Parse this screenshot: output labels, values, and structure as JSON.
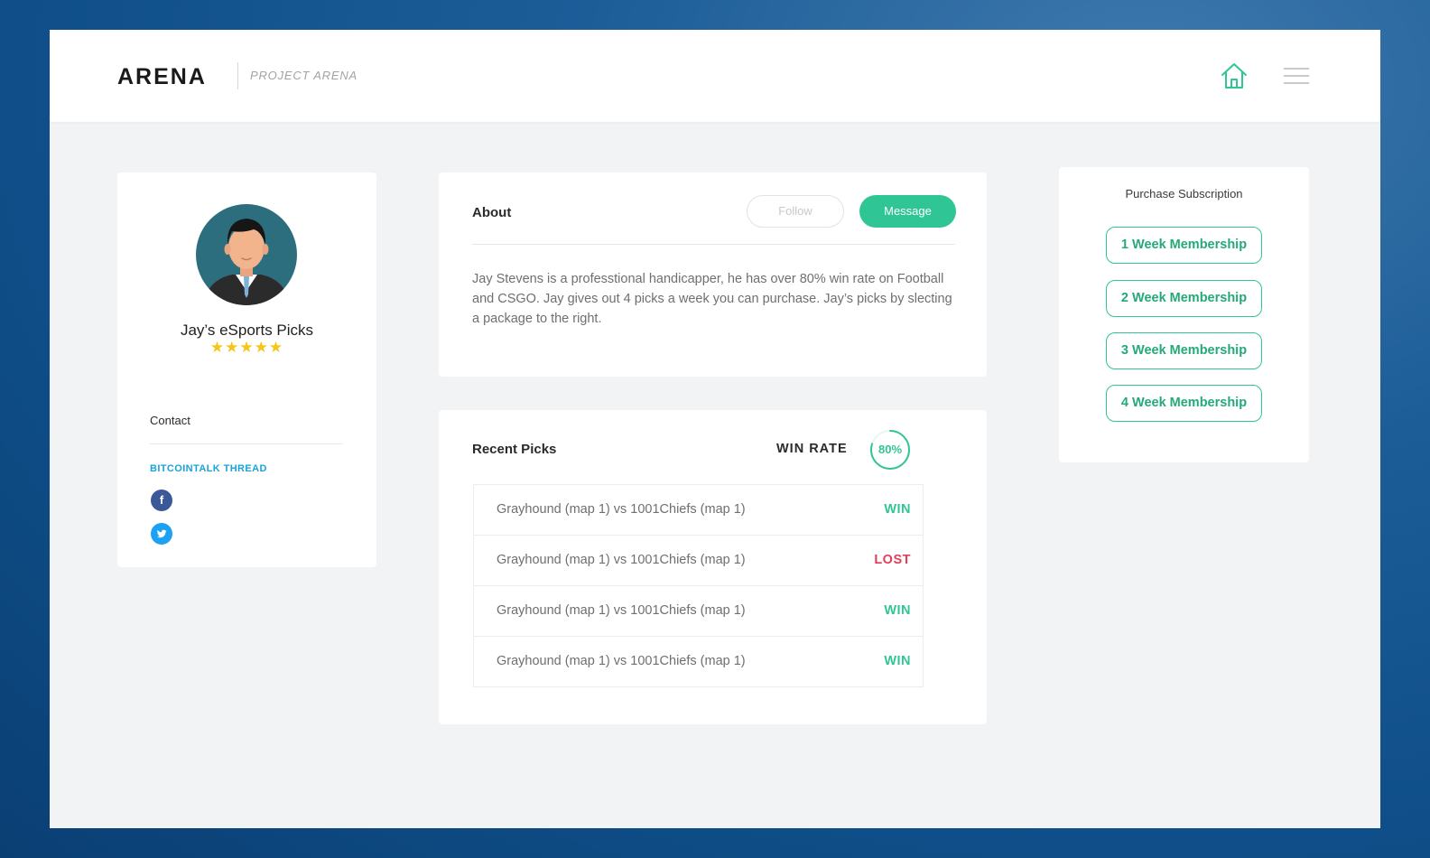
{
  "header": {
    "logo": "ARENA",
    "project_label": "PROJECT ARENA"
  },
  "profile": {
    "name": "Jay’s eSports Picks",
    "rating": 5,
    "stars": "★★★★★",
    "contact_label": "Contact",
    "thread_link": "BITCOINTALK THREAD",
    "facebook_glyph": "f"
  },
  "about": {
    "title": "About",
    "follow_label": "Follow",
    "message_label": "Message",
    "text": "Jay Stevens is a professtional handicapper, he has over 80% win rate on Football and CSGO. Jay gives out 4 picks a week you can purchase. Jay’s picks by slecting a package to the right."
  },
  "picks": {
    "title": "Recent Picks",
    "win_rate_label": "WIN RATE",
    "win_rate_value": "80%",
    "win_rate_fraction": 0.8,
    "rows": [
      {
        "match": "Grayhound (map 1) vs 1001Chiefs (map 1)",
        "result": "WIN"
      },
      {
        "match": "Grayhound (map 1) vs 1001Chiefs (map 1)",
        "result": "LOST"
      },
      {
        "match": "Grayhound (map 1) vs 1001Chiefs (map 1)",
        "result": "WIN"
      },
      {
        "match": "Grayhound (map 1) vs 1001Chiefs (map 1)",
        "result": "WIN"
      }
    ]
  },
  "subscription": {
    "title": "Purchase Subscription",
    "options": [
      {
        "label": "1 Week Membership"
      },
      {
        "label": "2 Week Membership"
      },
      {
        "label": "3 Week Membership"
      },
      {
        "label": "4 Week Membership"
      }
    ]
  },
  "colors": {
    "accent": "#2fc594",
    "lost": "#e23e57",
    "link": "#1aa3d9",
    "star": "#f5c518"
  },
  "icons": {
    "home": "home-icon",
    "menu": "hamburger-menu-icon",
    "facebook": "facebook-icon",
    "twitter": "twitter-icon",
    "avatar": "avatar-illustration"
  }
}
